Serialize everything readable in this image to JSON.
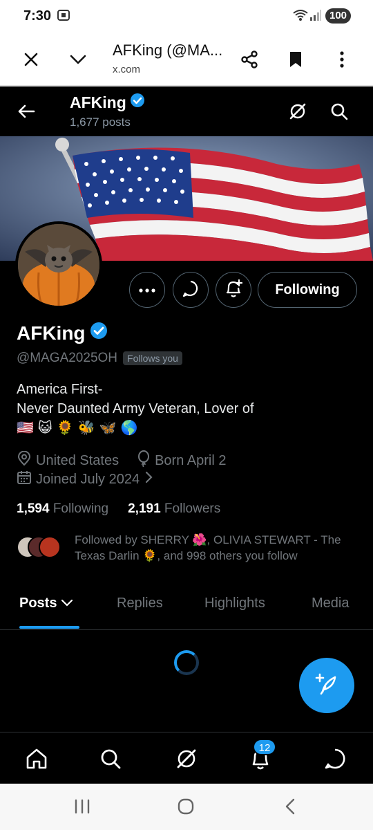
{
  "status_bar": {
    "time": "7:30",
    "battery": "100"
  },
  "browser": {
    "title": "AFKing (@MA...",
    "url": "x.com",
    "close_icon": "close-icon",
    "expand_icon": "chevron-down-icon",
    "share_icon": "share-icon",
    "bookmark_icon": "bookmark-icon",
    "menu_icon": "more-vert-icon"
  },
  "header": {
    "name": "AFKing",
    "posts_count": "1,677 posts"
  },
  "profile": {
    "name": "AFKing",
    "handle": "@MAGA2025OH",
    "follows_you": "Follows you",
    "following_button": "Following",
    "bio_line1": "America First-",
    "bio_line2": "Never Daunted Army Veteran, Lover of",
    "bio_emojis": [
      "🇺🇸",
      "😺",
      "🌻",
      "🐝",
      "🦋",
      "🌎"
    ],
    "location": "United States",
    "born": "Born April 2",
    "joined": "Joined July 2024",
    "following_count": "1,594",
    "following_label": "Following",
    "followers_count": "2,191",
    "followers_label": "Followers",
    "followed_by": "Followed by SHERRY 🌺, OLIVIA STEWART - The Texas Darlin 🌻, and 998 others you follow"
  },
  "tabs": [
    {
      "label": "Posts"
    },
    {
      "label": "Replies"
    },
    {
      "label": "Highlights"
    },
    {
      "label": "Media"
    }
  ],
  "bottom_nav": {
    "notifications_badge": "12"
  },
  "colors": {
    "accent": "#1d9bf0",
    "background": "#000000",
    "muted_text": "#71767b"
  }
}
